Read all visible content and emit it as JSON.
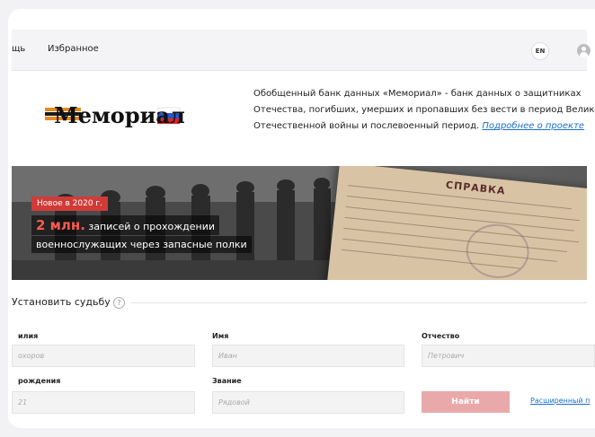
{
  "nav": {
    "help_label": "щь",
    "favorites_label": "Избранное",
    "lang_label": "EN"
  },
  "logo": {
    "text": "Мемориал"
  },
  "intro": {
    "line1": "Обобщенный банк данных «Мемориал» - банк данных о защитниках",
    "line2": "Отечества, погибших, умерших и пропавших без вести в период Велик",
    "line3_prefix": "Отечественной войны и послевоенный период. ",
    "link": "Подробнее о проекте"
  },
  "banner": {
    "badge": "Новое в 2020 г.",
    "count": "2 млн.",
    "line1_rest": " записей о прохождении",
    "line2": "военнослужащих через запасные полки",
    "document_title": "СПРАВКА"
  },
  "search": {
    "title": "Установить судьбу",
    "help": "?",
    "fields": {
      "surname": {
        "label": "илия",
        "placeholder": "охоров"
      },
      "name": {
        "label": "Имя",
        "placeholder": "Иван"
      },
      "patronymic": {
        "label": "Отчество",
        "placeholder": "Петрович"
      },
      "birth": {
        "label": "рождения",
        "placeholder": "21"
      },
      "rank": {
        "label": "Звание",
        "placeholder": "Рядовой"
      }
    },
    "submit": "Найти",
    "advanced": "Расширенный п"
  },
  "colors": {
    "accent": "#d13b37",
    "button": "#e9a9aa",
    "link": "#1a6fd0"
  }
}
